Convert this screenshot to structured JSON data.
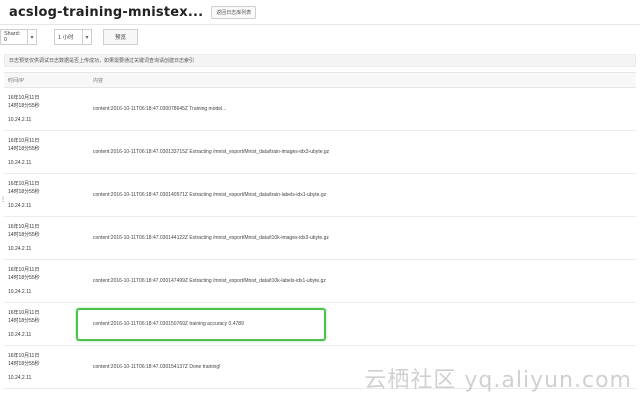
{
  "header": {
    "title": "acslog-training-mnistex...",
    "back_label": "返回日志库列表"
  },
  "toolbar": {
    "shard_value": "Shard: 0",
    "period_value": "1 小时",
    "preview_label": "预览"
  },
  "notice": "日志预览仅供调试日志数据是否上传成功，如果需要通过关键词查询请创建日志索引",
  "table": {
    "columns": {
      "time": "时间/IP",
      "content": "内容"
    },
    "rows": [
      {
        "date": "16年10月11日",
        "time": "14时18分55秒",
        "ip": "10.24.2.11",
        "content": "content:2016-10-11T06:18:47.030078645Z Training model..."
      },
      {
        "date": "16年10月11日",
        "time": "14时18分55秒",
        "ip": "10.24.2.11",
        "content": "content:2016-10-11T06:18:47.030133715Z Extracting /mnist_export/Mnist_data/train-images-idx3-ubyte.gz"
      },
      {
        "date": "16年10月11日",
        "time": "14时18分55秒",
        "ip": "10.24.2.11",
        "content": "content:2016-10-11T06:18:47.030140571Z Extracting /mnist_export/Mnist_data/train-labels-idx1-ubyte.gz"
      },
      {
        "date": "16年10月11日",
        "time": "14时18分55秒",
        "ip": "10.24.2.11",
        "content": "content:2016-10-11T06:18:47.030144122Z Extracting /mnist_export/Mnist_data/t10k-images-idx3-ubyte.gz"
      },
      {
        "date": "16年10月11日",
        "time": "14时18分55秒",
        "ip": "10.24.2.11",
        "content": "content:2016-10-11T06:18:47.030147499Z Extracting /mnist_export/Mnist_data/t10k-labels-idx1-ubyte.gz"
      },
      {
        "date": "16年10月11日",
        "time": "14时18分55秒",
        "ip": "10.24.2.11",
        "content": "content:2016-10-11T06:18:47.030150769Z training accuracy 0.4789"
      },
      {
        "date": "16年10月11日",
        "time": "14时18分55秒",
        "ip": "10.24.2.11",
        "content": "content:2016-10-11T06:18:47.030154137Z Done training!"
      }
    ]
  },
  "watermark": "云栖社区 yq.aliyun.com",
  "colors": {
    "highlight": "#4ec24e"
  }
}
